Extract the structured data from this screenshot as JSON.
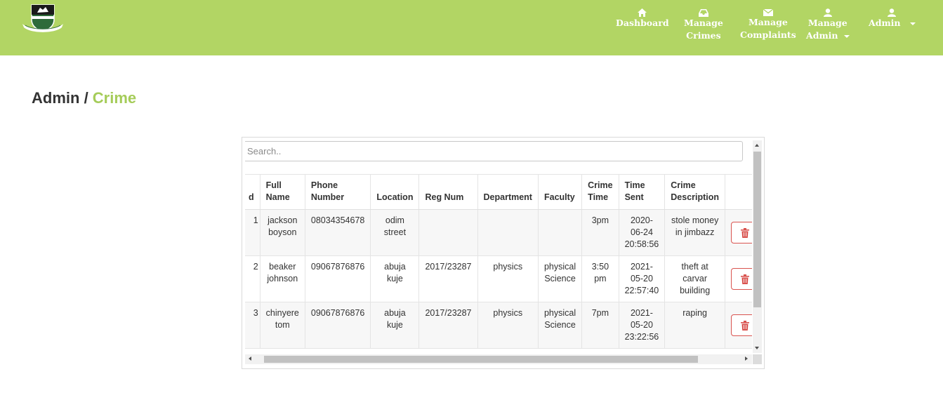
{
  "brand": {
    "logo_icon": "university-crest-logo"
  },
  "nav": {
    "dashboard": {
      "line1": "Dashboard",
      "icon": "home-icon"
    },
    "manage_crimes": {
      "line1": "Manage",
      "line2": "Crimes",
      "icon": "inbox-icon"
    },
    "manage_complaints": {
      "line1": "Manage",
      "line2": "Complaints",
      "icon": "envelope-icon"
    },
    "manage_admin": {
      "line1": "Manage",
      "line2": "Admin",
      "icon": "user-icon"
    },
    "admin_menu": {
      "line1": "Admin",
      "icon": "user-icon"
    }
  },
  "breadcrumb": {
    "parent": "Admin",
    "separator": " / ",
    "current": "Crime"
  },
  "search": {
    "placeholder": "Search..",
    "value": ""
  },
  "table": {
    "headers": {
      "id": "d",
      "full_name_1": "Full",
      "full_name_2": "Name",
      "phone_1": "Phone",
      "phone_2": "Number",
      "location": "Location",
      "reg_num": "Reg Num",
      "department": "Department",
      "faculty": "Faculty",
      "crime_time_1": "Crime",
      "crime_time_2": "Time",
      "time_sent_1": "Time",
      "time_sent_2": "Sent",
      "desc_1": "Crime",
      "desc_2": "Description"
    },
    "rows": [
      {
        "id": "1",
        "name_1": "jackson",
        "name_2": "boyson",
        "phone": "08034354678",
        "loc_1": "odim",
        "loc_2": "street",
        "reg": "",
        "dept": "",
        "fac_1": "",
        "fac_2": "",
        "time_1": "3pm",
        "time_2": "",
        "sent_1": "2020-",
        "sent_2": "06-24",
        "sent_3": "20:58:56",
        "desc_1": "stole money",
        "desc_2": "in jimbazz",
        "desc_3": ""
      },
      {
        "id": "2",
        "name_1": "beaker",
        "name_2": "johnson",
        "phone": "09067876876",
        "loc_1": "abuja",
        "loc_2": "kuje",
        "reg": "2017/23287",
        "dept": "physics",
        "fac_1": "physical",
        "fac_2": "Science",
        "time_1": "3:50",
        "time_2": "pm",
        "sent_1": "2021-",
        "sent_2": "05-20",
        "sent_3": "22:57:40",
        "desc_1": "theft at",
        "desc_2": "carvar",
        "desc_3": "building"
      },
      {
        "id": "3",
        "name_1": "chinyere",
        "name_2": "tom",
        "phone": "09067876876",
        "loc_1": "abuja",
        "loc_2": "kuje",
        "reg": "2017/23287",
        "dept": "physics",
        "fac_1": "physical",
        "fac_2": "Science",
        "time_1": "7pm",
        "time_2": "",
        "sent_1": "2021-",
        "sent_2": "05-20",
        "sent_3": "23:22:56",
        "desc_1": "raping",
        "desc_2": "",
        "desc_3": ""
      }
    ],
    "delete_icon": "trash-icon"
  },
  "colors": {
    "navbar": "#b2d564",
    "accent": "#a5cc59",
    "danger": "#d9534f"
  }
}
